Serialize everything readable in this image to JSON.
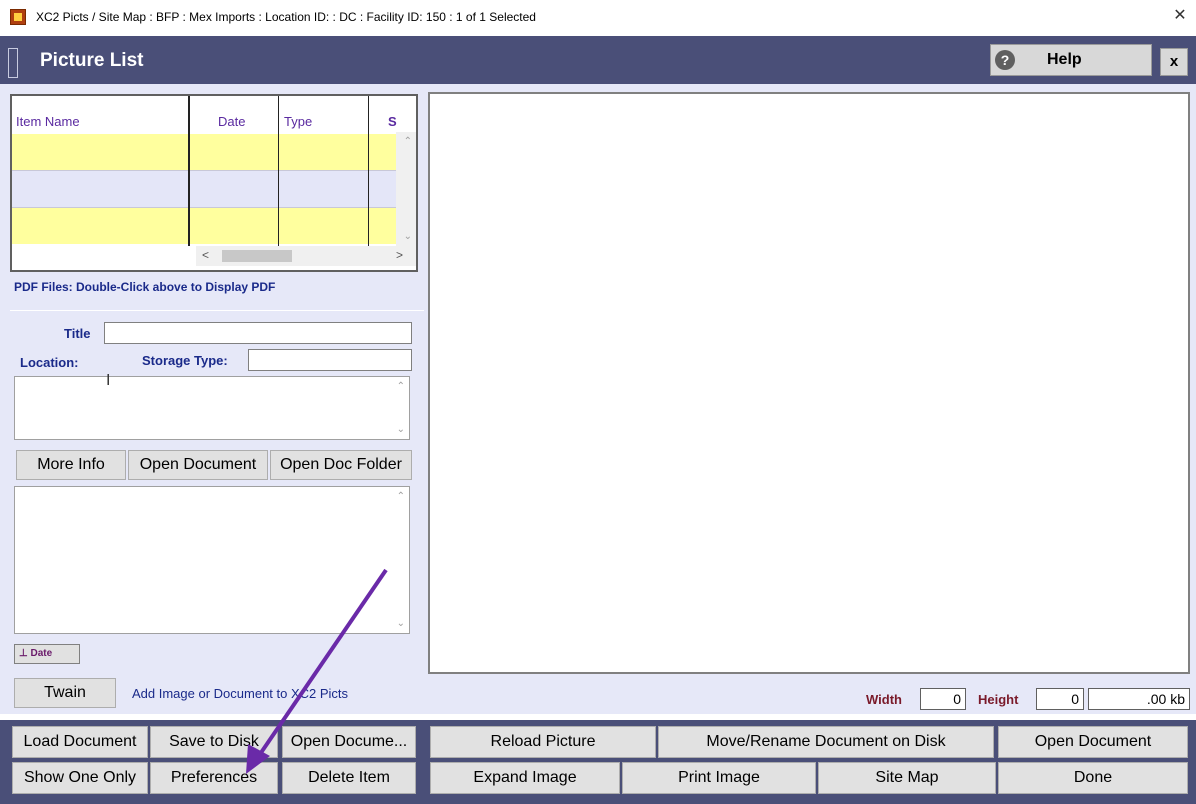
{
  "window": {
    "title": "XC2 Picts / Site Map :  BFP : Mex Imports : Location ID:  : DC : Facility ID:  150 : 1 of 1 Selected",
    "close_glyph": "✕"
  },
  "header": {
    "title": "Picture List",
    "help_label": "Help",
    "close_label": "x"
  },
  "grid": {
    "columns": [
      "Item Name",
      "Date",
      "Type",
      "S"
    ],
    "row_colors": [
      "#ffff9e",
      "#e4e6f8",
      "#ffff9e"
    ],
    "scroll_left": "<",
    "scroll_right": ">"
  },
  "pdf_hint": "PDF Files:  Double-Click above to Display PDF",
  "form": {
    "title_label": "Title",
    "title_value": "",
    "location_label": "Location:",
    "storage_type_label": "Storage Type:",
    "storage_type_value": ""
  },
  "buttons": {
    "more_info": "More Info",
    "open_document_small": "Open Document",
    "open_doc_folder": "Open Doc Folder",
    "date": "Date",
    "twain": "Twain"
  },
  "add_image_text": "Add Image or Document to XC2 Picts",
  "image_info": {
    "width_label": "Width",
    "width_value": "0",
    "height_label": "Height",
    "height_value": "0",
    "size_value": ".00 kb"
  },
  "bottom": {
    "row1": [
      "Load Document",
      "Save to Disk",
      "Open Docume...",
      "Reload Picture",
      "Move/Rename Document on Disk",
      "Open Document"
    ],
    "row2": [
      "Show One Only",
      "Preferences",
      "Delete Item",
      "Expand Image",
      "Print Image",
      "Site Map",
      "Done"
    ]
  },
  "colors": {
    "header_bg": "#4a4f78",
    "panel_bg": "#e6e8f8",
    "arrow": "#6a2aa8"
  }
}
